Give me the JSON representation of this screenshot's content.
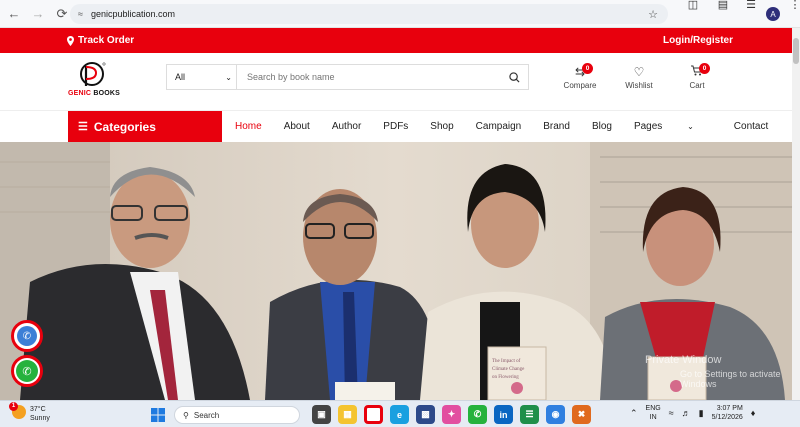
{
  "browser": {
    "url": "genicpublication.com",
    "back_icon": "arrow-left-icon",
    "forward_icon": "arrow-right-icon",
    "reload_icon": "reload-icon"
  },
  "topbar": {
    "track_order": "Track Order",
    "login_register": "Login/Register"
  },
  "logo": {
    "brand_left": "GENIC",
    "brand_right": "BOOKS"
  },
  "search": {
    "category_selected": "All",
    "placeholder": "Search by book name"
  },
  "header_icons": {
    "compare_label": "Compare",
    "compare_count": "0",
    "wishlist_label": "Wishlist",
    "cart_label": "Cart",
    "cart_count": "0"
  },
  "nav": {
    "categories_label": "Categories",
    "items": [
      "Home",
      "About",
      "Author",
      "PDFs",
      "Shop",
      "Campaign",
      "Brand",
      "Blog",
      "Pages",
      "Contact"
    ]
  },
  "hero": {
    "book_title": "The Impact of Climate Change on Flowering"
  },
  "watermark": {
    "line1": "Private Window",
    "line2": "Go to Settings to activate Windows"
  },
  "taskbar": {
    "temperature": "37°C",
    "weather": "Sunny",
    "weather_badge": "1",
    "search_label": "Search",
    "lang_line1": "ENG",
    "lang_line2": "IN",
    "time": "3:07 PM",
    "date": "5/12/2026"
  },
  "colors": {
    "brand_red": "#e8000d",
    "whatsapp_green": "#25b23d"
  }
}
